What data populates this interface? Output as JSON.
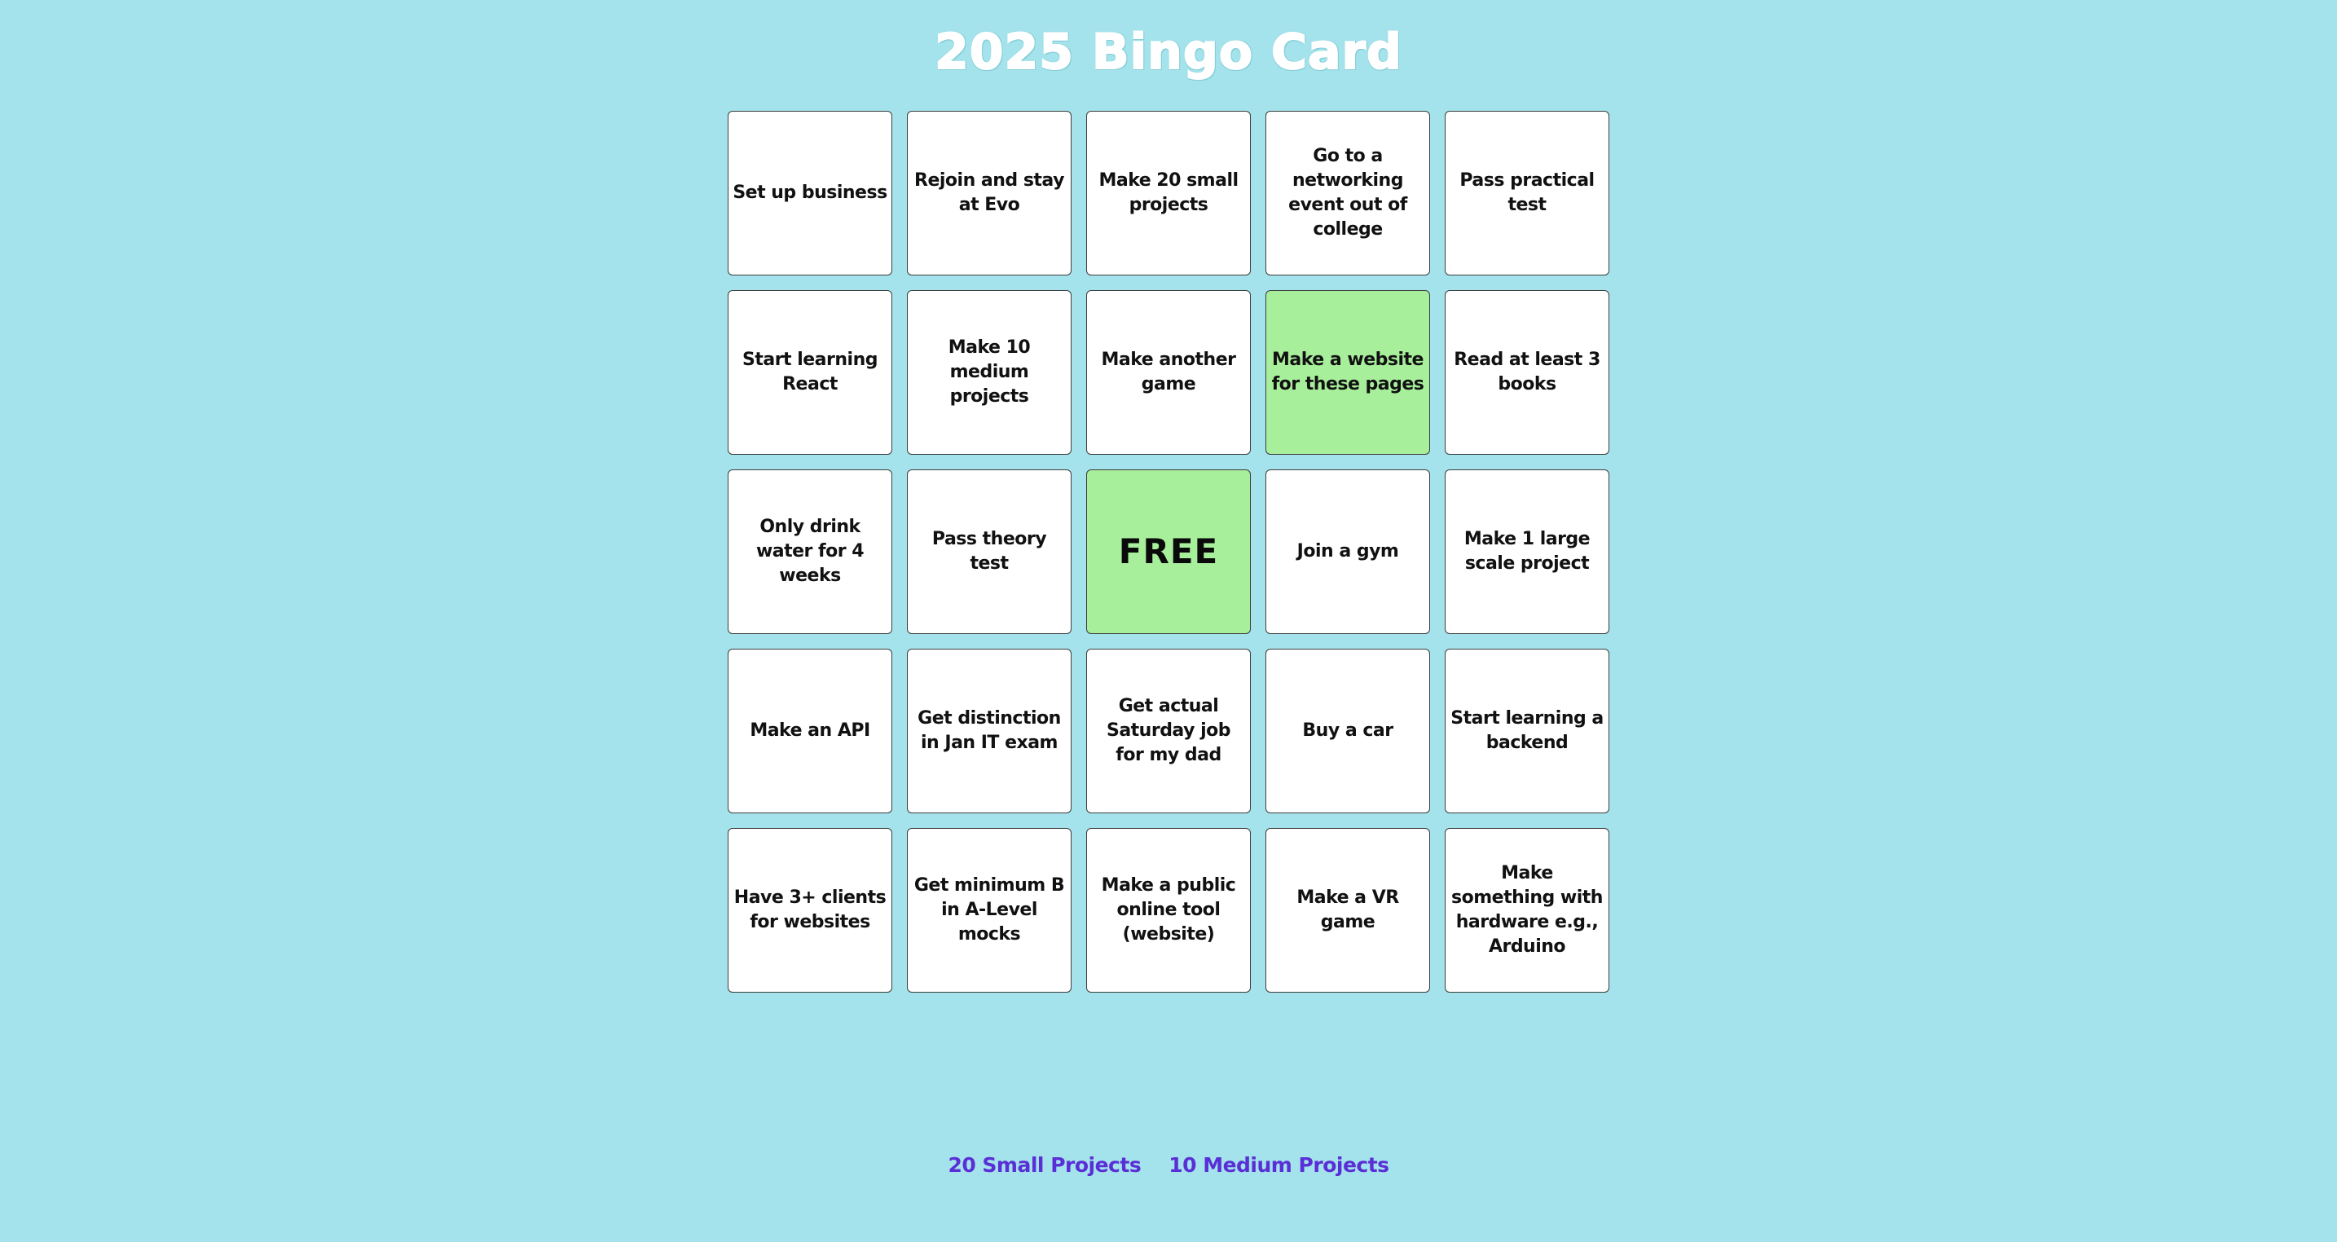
{
  "page": {
    "title": "2025 Bingo Card",
    "background_color": "#a4e3eb",
    "completed_color": "#a8ef9b",
    "link_color": "#5a2fd6"
  },
  "bingo": {
    "cells": [
      {
        "label": "Set up business",
        "completed": false
      },
      {
        "label": "Rejoin and stay at Evo",
        "completed": false
      },
      {
        "label": "Make 20 small projects",
        "completed": false
      },
      {
        "label": "Go to a networking event out of college",
        "completed": false
      },
      {
        "label": "Pass practical test",
        "completed": false
      },
      {
        "label": "Start learning React",
        "completed": false
      },
      {
        "label": "Make 10 medium projects",
        "completed": false
      },
      {
        "label": "Make another game",
        "completed": false
      },
      {
        "label": "Make a website for these pages",
        "completed": true
      },
      {
        "label": "Read at least 3 books",
        "completed": false
      },
      {
        "label": "Only drink water for 4 weeks",
        "completed": false
      },
      {
        "label": "Pass theory test",
        "completed": false
      },
      {
        "label": "FREE",
        "completed": true,
        "free": true
      },
      {
        "label": "Join a gym",
        "completed": false
      },
      {
        "label": "Make 1 large scale project",
        "completed": false
      },
      {
        "label": "Make an API",
        "completed": false
      },
      {
        "label": "Get distinction in Jan IT exam",
        "completed": false
      },
      {
        "label": "Get actual Saturday job for my dad",
        "completed": false
      },
      {
        "label": "Buy a car",
        "completed": false
      },
      {
        "label": "Start learning a backend",
        "completed": false
      },
      {
        "label": "Have 3+ clients for websites",
        "completed": false
      },
      {
        "label": "Get minimum B in A-Level mocks",
        "completed": false
      },
      {
        "label": "Make a public online tool (website)",
        "completed": false
      },
      {
        "label": "Make a VR game",
        "completed": false
      },
      {
        "label": "Make something with hardware e.g., Arduino",
        "completed": false
      }
    ]
  },
  "footer": {
    "links": [
      {
        "label": "20 Small Projects"
      },
      {
        "label": "10 Medium Projects"
      }
    ]
  }
}
